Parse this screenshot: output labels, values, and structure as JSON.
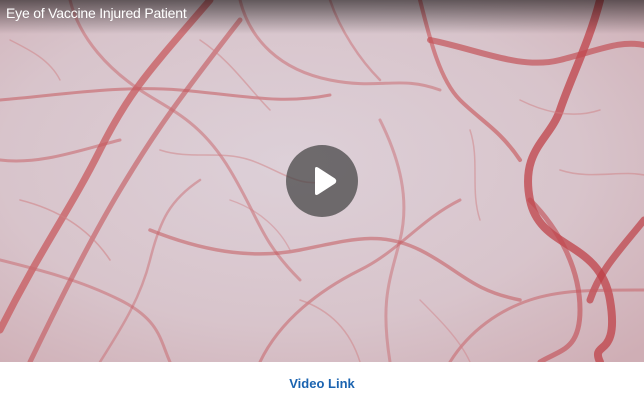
{
  "video": {
    "title": "Eye of Vaccine Injured Patient",
    "play_icon": "play-icon",
    "background_color": "#d9c6cc",
    "vessel_color": "#c24a4c"
  },
  "link": {
    "label": "Video Link",
    "color": "#1a63b0"
  }
}
